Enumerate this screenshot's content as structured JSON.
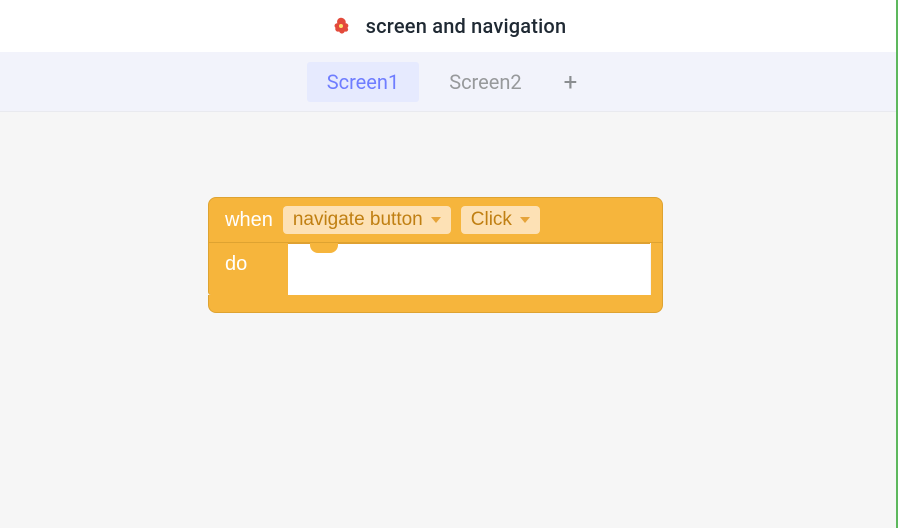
{
  "header": {
    "title": "screen and navigation"
  },
  "tabs": {
    "items": [
      {
        "label": "Screen1",
        "active": true
      },
      {
        "label": "Screen2",
        "active": false
      }
    ],
    "add_symbol": "+"
  },
  "block": {
    "when_label": "when",
    "do_label": "do",
    "component_dropdown": {
      "value": "navigate button"
    },
    "event_dropdown": {
      "value": "Click"
    }
  }
}
